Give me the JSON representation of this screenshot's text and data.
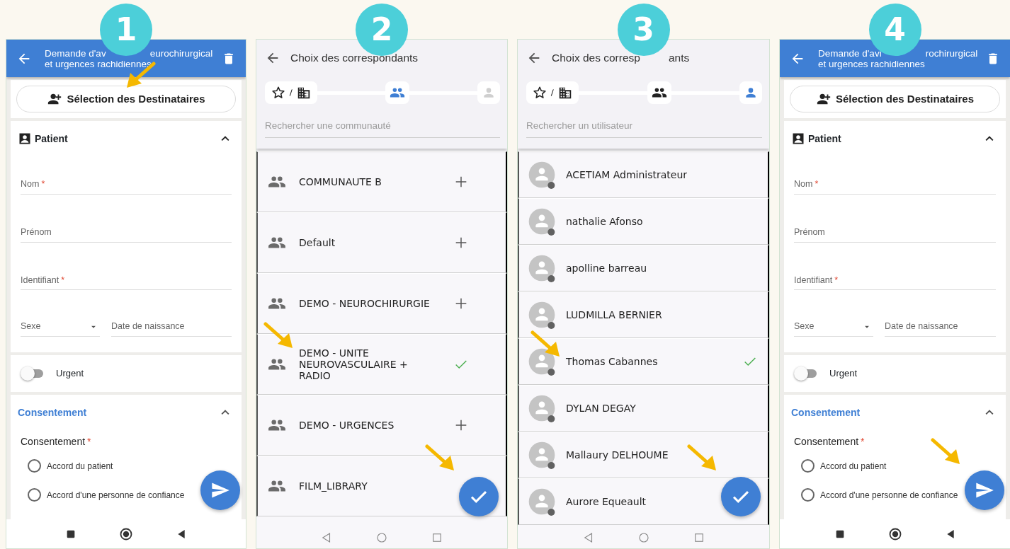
{
  "screens": [
    {
      "kind": "form",
      "step": "1",
      "title_start": "Demande d'av",
      "title_end": "eurochirurgical",
      "title_line2": "et urgences rachidiennes",
      "recipients_button": {
        "label": "Sélection des Destinataires",
        "pointed": true
      },
      "patient": {
        "title": "Patient",
        "expanded": true
      },
      "fields": [
        {
          "label": "Nom",
          "required_mark": "*"
        },
        {
          "label": "Prénom"
        },
        {
          "label": "Identifiant",
          "required_mark": "*"
        }
      ],
      "sex_field": "Sexe",
      "birthdate_field": "Date de naissance",
      "urgent": {
        "label": "Urgent",
        "on": false
      },
      "consent": {
        "title": "Consentement",
        "expanded": true,
        "label": "Consentement",
        "required_mark": "*",
        "options": [
          {
            "label": "Accord du patient",
            "selected": false
          },
          {
            "label": "Accord d'une personne de confiance",
            "selected": false
          }
        ]
      },
      "fab": {
        "kind": "send",
        "pointed": false
      },
      "nav_bar": {
        "kind": "filled"
      }
    },
    {
      "kind": "list",
      "step": "2",
      "title_start": "Choix des correspondants",
      "steps": [
        {
          "kind": "favorites",
          "selected": false
        },
        {
          "kind": "community",
          "selected": true
        },
        {
          "kind": "user",
          "selected": false
        }
      ],
      "search": {
        "placeholder": "Rechercher une communauté"
      },
      "items": [
        {
          "kind": "community",
          "label": "COMMUNAUTE B",
          "selected": false,
          "pointed": false
        },
        {
          "kind": "community",
          "label": "Default",
          "selected": false,
          "pointed": false
        },
        {
          "kind": "community",
          "label": "DEMO - NEUROCHIRURGIE",
          "selected": false,
          "pointed": false
        },
        {
          "kind": "community",
          "label": "DEMO - UNITE NEUROVASCULAIRE + RADIO",
          "selected": true,
          "pointed": true
        },
        {
          "kind": "community",
          "label": "DEMO - URGENCES",
          "selected": false,
          "pointed": false
        },
        {
          "kind": "community",
          "label": "FILM_LIBRARY",
          "pointed": false
        }
      ],
      "fab": {
        "kind": "confirm",
        "pointed": true
      },
      "nav_bar": {
        "kind": "outline"
      }
    },
    {
      "kind": "list",
      "step": "3",
      "title_start": "Choix des corresp",
      "title_end": "ants",
      "steps": [
        {
          "kind": "favorites",
          "selected": false
        },
        {
          "kind": "community",
          "selected": false
        },
        {
          "kind": "user",
          "selected": true
        }
      ],
      "search": {
        "placeholder": "Rechercher un utilisateur"
      },
      "items": [
        {
          "kind": "user",
          "label": "ACETIAM Administrateur",
          "selected": false,
          "pointed": false
        },
        {
          "kind": "user",
          "label": "nathalie Afonso",
          "selected": false,
          "pointed": false
        },
        {
          "kind": "user",
          "label": "apolline barreau",
          "selected": false,
          "pointed": false
        },
        {
          "kind": "user",
          "label": "LUDMILLA BERNIER",
          "selected": false,
          "pointed": false
        },
        {
          "kind": "user",
          "label": "Thomas Cabannes",
          "selected": true,
          "pointed": true
        },
        {
          "kind": "user",
          "label": "DYLAN DEGAY",
          "selected": false,
          "pointed": false
        },
        {
          "kind": "user",
          "label": "Mallaury DELHOUME",
          "selected": false,
          "pointed": false
        },
        {
          "kind": "user",
          "label": "Aurore Equeault",
          "selected": false,
          "pointed": false
        }
      ],
      "fab": {
        "kind": "confirm",
        "pointed": true
      },
      "nav_bar": {
        "kind": "outline"
      }
    },
    {
      "kind": "form",
      "step": "4",
      "title_start": "Demande d'avi",
      "title_end": "rochirurgical",
      "title_line2": "et urgences rachidiennes",
      "recipients_button": {
        "label": "Sélection des Destinataires",
        "pointed": false
      },
      "patient": {
        "title": "Patient",
        "expanded": true
      },
      "fields": [
        {
          "label": "Nom",
          "required_mark": "*"
        },
        {
          "label": "Prénom"
        },
        {
          "label": "Identifiant",
          "required_mark": "*"
        }
      ],
      "sex_field": "Sexe",
      "birthdate_field": "Date de naissance",
      "urgent": {
        "label": "Urgent",
        "on": false
      },
      "consent": {
        "title": "Consentement",
        "expanded": true,
        "label": "Consentement",
        "required_mark": "*",
        "options": [
          {
            "label": "Accord du patient",
            "selected": false
          },
          {
            "label": "Accord d'une personne de confiance",
            "selected": false
          }
        ]
      },
      "fab": {
        "kind": "send",
        "pointed": true
      },
      "nav_bar": {
        "kind": "filled"
      }
    }
  ]
}
